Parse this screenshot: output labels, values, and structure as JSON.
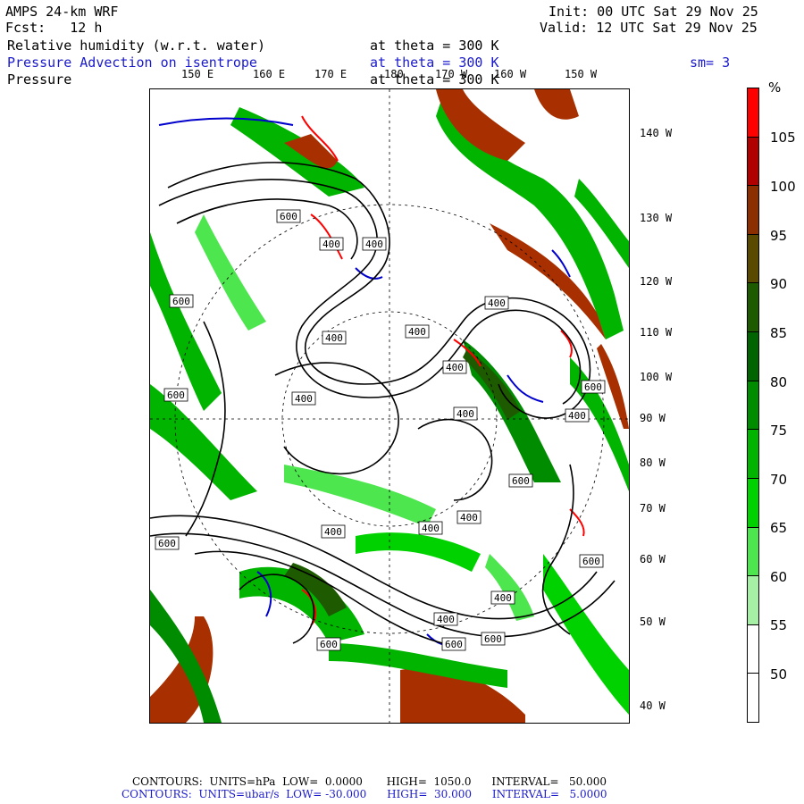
{
  "header": {
    "model": "AMPS 24-km WRF",
    "init": "Init: 00 UTC Sat 29 Nov 25",
    "fcst": "Fcst:   12 h",
    "valid": "Valid: 12 UTC Sat 29 Nov 25",
    "field1": "Relative humidity (w.r.t. water)",
    "field1_level": "at theta = 300 K",
    "field2": "Pressure Advection on isentrope",
    "field2_level": "at theta = 300 K",
    "smoothing": "sm= 3",
    "field3": "Pressure",
    "field3_level": "at theta = 300 K"
  },
  "map": {
    "top_longitude_labels": [
      "150 E",
      "160 E",
      "170 E",
      "180",
      "170 W",
      "160 W",
      "150 W"
    ],
    "right_longitude_labels": [
      "140 W",
      "130 W",
      "120 W",
      "110 W",
      "100 W",
      "90 W",
      "80 W",
      "70 W",
      "60 W",
      "50 W",
      "40 W"
    ],
    "contour_labels": [
      "600",
      "400",
      "400",
      "400",
      "600",
      "400",
      "400",
      "400",
      "600",
      "600",
      "400",
      "400",
      "400",
      "600",
      "400",
      "400",
      "400",
      "400",
      "600",
      "600",
      "400",
      "600",
      "600",
      "400",
      "600"
    ]
  },
  "colorbar": {
    "unit": "%",
    "labels": [
      "105",
      "100",
      "95",
      "90",
      "85",
      "80",
      "75",
      "70",
      "65",
      "60",
      "55",
      "50"
    ],
    "colors": [
      "#ff0000",
      "#b00000",
      "#8b2e00",
      "#5a4a00",
      "#1e5a00",
      "#006400",
      "#008c00",
      "#00b400",
      "#00d200",
      "#4ee64e",
      "#a6f0a6",
      "#ffffff",
      "#ffffff"
    ]
  },
  "footer": {
    "line1": "CONTOURS:  UNITS=hPa  LOW=  0.0000       HIGH=  1050.0      INTERVAL=   50.000",
    "line2": "CONTOURS:  UNITS=ubar/s  LOW= -30.000      HIGH=  30.000      INTERVAL=   5.0000"
  }
}
